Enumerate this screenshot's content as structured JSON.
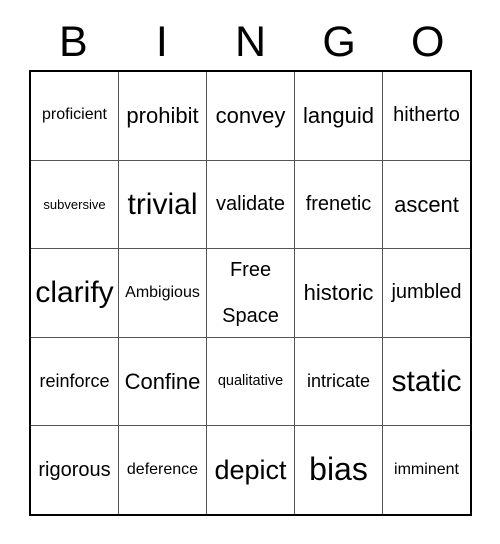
{
  "card": {
    "header_letters": [
      "B",
      "I",
      "N",
      "G",
      "O"
    ],
    "rows": [
      [
        {
          "text": "proficient",
          "size": "fs-s"
        },
        {
          "text": "prohibit",
          "size": "fs-xl"
        },
        {
          "text": "convey",
          "size": "fs-xl"
        },
        {
          "text": "languid",
          "size": "fs-xl"
        },
        {
          "text": "hitherto",
          "size": "fs-l"
        }
      ],
      [
        {
          "text": "subversive",
          "size": "fs-xxs"
        },
        {
          "text": "trivial",
          "size": "fs-3xl"
        },
        {
          "text": "validate",
          "size": "fs-l"
        },
        {
          "text": "frenetic",
          "size": "fs-l"
        },
        {
          "text": "ascent",
          "size": "fs-xl"
        }
      ],
      [
        {
          "text": "clarify",
          "size": "fs-3xl"
        },
        {
          "text": "Ambigious",
          "size": "fs-s"
        },
        {
          "text": "Free Space",
          "size": "fs-l",
          "free_space": true,
          "line1": "Free",
          "line2": "Space"
        },
        {
          "text": "historic",
          "size": "fs-xl"
        },
        {
          "text": "jumbled",
          "size": "fs-l"
        }
      ],
      [
        {
          "text": "reinforce",
          "size": "fs-m"
        },
        {
          "text": "Confine",
          "size": "fs-xl"
        },
        {
          "text": "qualitative",
          "size": "fs-xs"
        },
        {
          "text": "intricate",
          "size": "fs-m"
        },
        {
          "text": "static",
          "size": "fs-3xl"
        }
      ],
      [
        {
          "text": "rigorous",
          "size": "fs-l"
        },
        {
          "text": "deference",
          "size": "fs-s"
        },
        {
          "text": "depict",
          "size": "fs-2xl"
        },
        {
          "text": "bias",
          "size": "fs-4xl"
        },
        {
          "text": "imminent",
          "size": "fs-s"
        }
      ]
    ]
  },
  "colors": {
    "background": "#ffffff",
    "text": "#000000",
    "outer_border": "#000000",
    "inner_gridline": "#555555"
  }
}
